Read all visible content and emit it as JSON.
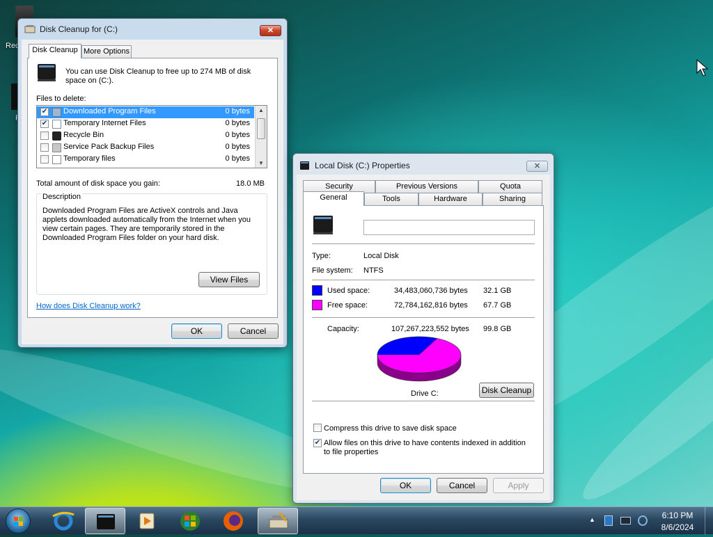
{
  "desktop": {
    "icons": [
      {
        "label": "Rec"
      },
      {
        "label": "F"
      }
    ]
  },
  "disk_cleanup": {
    "title": "Disk Cleanup for  (C:)",
    "tabs": [
      {
        "label": "Disk Cleanup"
      },
      {
        "label": "More Options"
      }
    ],
    "intro": "You can use Disk Cleanup to free up to 274 MB of disk space on  (C:).",
    "files_label": "Files to delete:",
    "files": [
      {
        "name": "Downloaded Program Files",
        "size": "0 bytes",
        "checked": true,
        "selected": true
      },
      {
        "name": "Temporary Internet Files",
        "size": "0 bytes",
        "checked": true,
        "selected": false
      },
      {
        "name": "Recycle Bin",
        "size": "0 bytes",
        "checked": false,
        "selected": false
      },
      {
        "name": "Service Pack Backup Files",
        "size": "0 bytes",
        "checked": false,
        "selected": false
      },
      {
        "name": "Temporary files",
        "size": "0 bytes",
        "checked": false,
        "selected": false
      }
    ],
    "total_label": "Total amount of disk space you gain:",
    "total_value": "18.0 MB",
    "description_label": "Description",
    "description": "Downloaded Program Files are ActiveX controls and Java applets downloaded automatically from the Internet when you view certain pages. They are temporarily stored in the Downloaded Program Files folder on your hard disk.",
    "view_files": "View Files",
    "help_link": "How does Disk Cleanup work?",
    "ok": "OK",
    "cancel": "Cancel"
  },
  "properties": {
    "title": "Local Disk (C:) Properties",
    "tabs_row1": [
      {
        "label": "Security"
      },
      {
        "label": "Previous Versions"
      },
      {
        "label": "Quota"
      }
    ],
    "tabs_row2": [
      {
        "label": "General"
      },
      {
        "label": "Tools"
      },
      {
        "label": "Hardware"
      },
      {
        "label": "Sharing"
      }
    ],
    "volume_label_value": "",
    "type_label": "Type:",
    "type_value": "Local Disk",
    "fs_label": "File system:",
    "fs_value": "NTFS",
    "used_label": "Used space:",
    "used_bytes": "34,483,060,736 bytes",
    "used_gb": "32.1 GB",
    "free_label": "Free space:",
    "free_bytes": "72,784,162,816 bytes",
    "free_gb": "67.7 GB",
    "capacity_label": "Capacity:",
    "capacity_bytes": "107,267,223,552 bytes",
    "capacity_gb": "99.8 GB",
    "drive_label": "Drive C:",
    "disk_cleanup_btn": "Disk Cleanup",
    "compress_label": "Compress this drive to save disk space",
    "compress_checked": false,
    "index_label": "Allow files on this drive to have contents indexed in addition to file properties",
    "index_checked": true,
    "ok": "OK",
    "cancel": "Cancel",
    "apply": "Apply",
    "colors": {
      "used": "#0000ff",
      "free": "#ff00ff"
    },
    "used_fraction": 0.321
  },
  "taskbar": {
    "time": "6:10 PM",
    "date": "8/6/2024"
  }
}
